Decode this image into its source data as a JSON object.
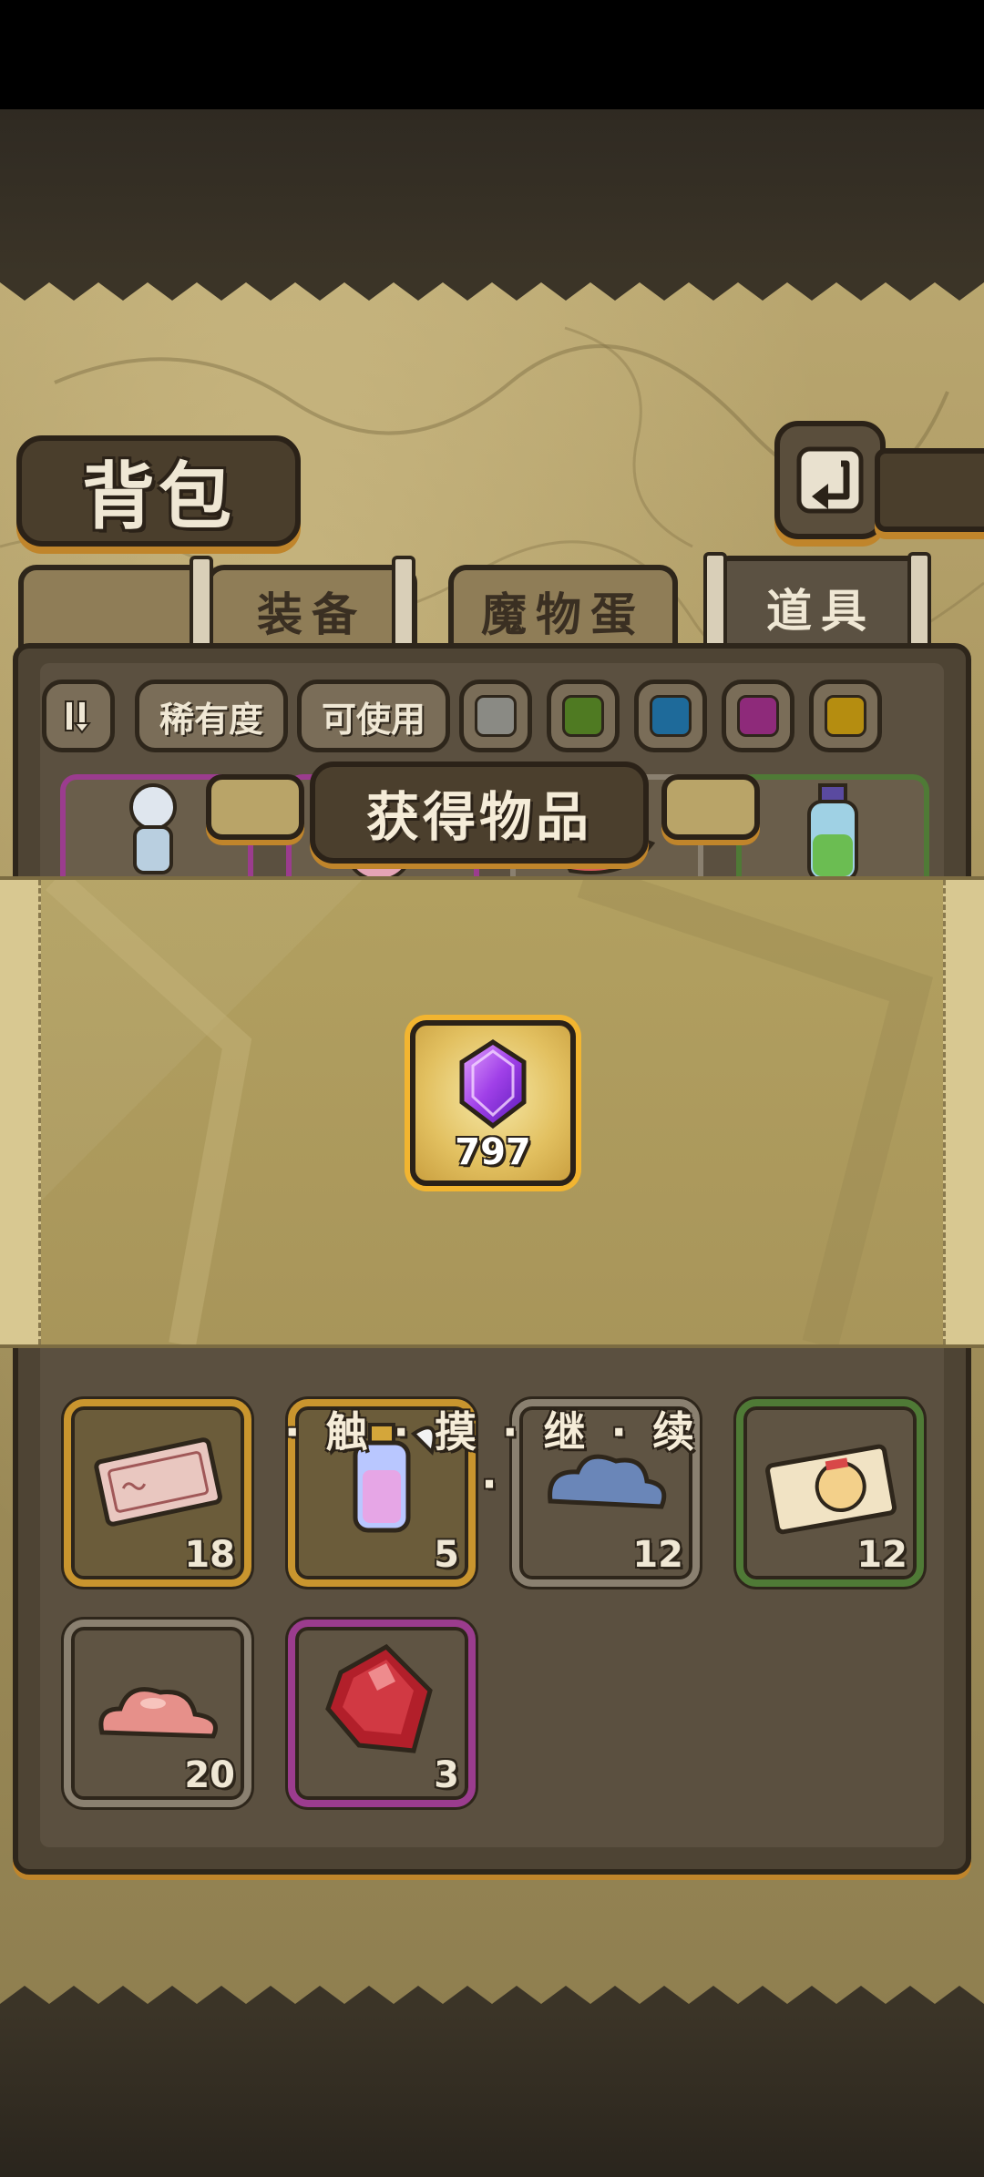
{
  "screen": {
    "title": "背包",
    "back_icon": "return-arrow-icon"
  },
  "tabs": [
    {
      "label": "装备",
      "active": false
    },
    {
      "label": "魔物蛋",
      "active": false
    },
    {
      "label": "道具",
      "active": true
    }
  ],
  "filters": {
    "sort_icon": "sort-order-icon",
    "rarity_label": "稀有度",
    "usable_label": "可使用",
    "swatches": [
      "#8a8a84",
      "#4f7a22",
      "#1e6a9a",
      "#8e2a7a",
      "#b58d10"
    ]
  },
  "items": [
    {
      "icon": "ticket-icon",
      "qty": "18",
      "frame": "gold"
    },
    {
      "icon": "winged-lantern-icon",
      "qty": "5",
      "frame": "gold"
    },
    {
      "icon": "blue-cloud-slime-icon",
      "qty": "12",
      "frame": "gray"
    },
    {
      "icon": "character-ticket-icon",
      "qty": "12",
      "frame": "green"
    },
    {
      "icon": "pink-slime-icon",
      "qty": "20",
      "frame": "gray"
    },
    {
      "icon": "red-gem-icon",
      "qty": "3",
      "frame": "purple"
    }
  ],
  "popup": {
    "title": "获得物品",
    "reward": {
      "icon": "purple-crystal-icon",
      "qty": "797"
    },
    "continue_hint": "· 触 · 摸 · 继 · 续 ·"
  },
  "colors": {
    "parchment": "#a7945d",
    "frame_dark": "#2e261b",
    "accent_orange": "#c0852b"
  }
}
